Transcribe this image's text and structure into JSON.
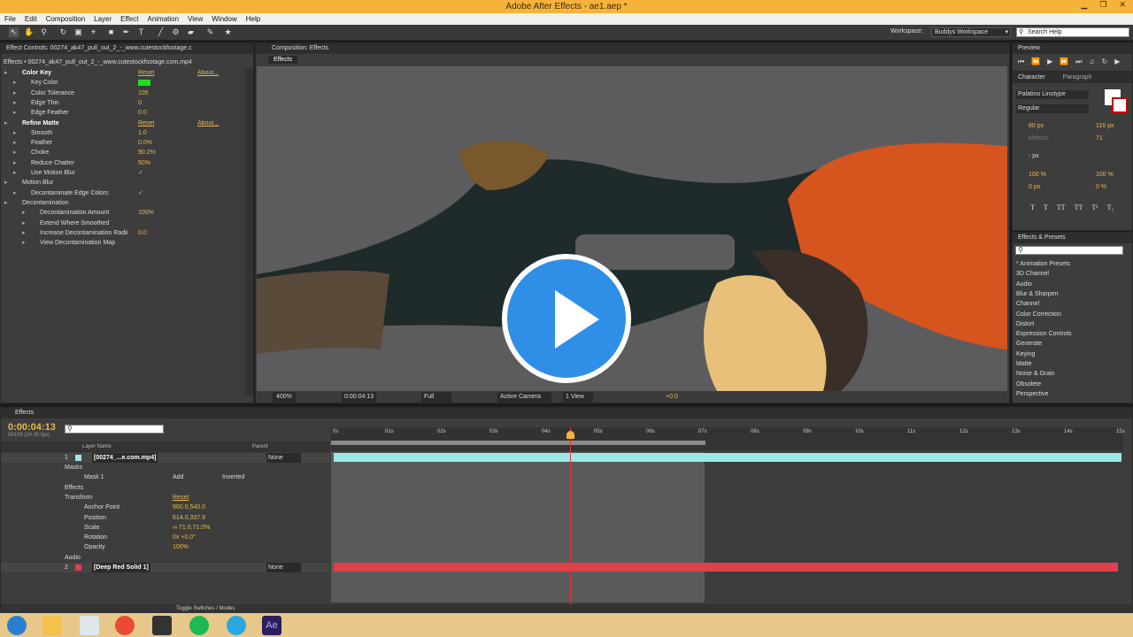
{
  "window": {
    "title": "Adobe After Effects - ae1.aep *"
  },
  "menu": [
    "File",
    "Edit",
    "Composition",
    "Layer",
    "Effect",
    "Animation",
    "View",
    "Window",
    "Help"
  ],
  "toolbar": {
    "workspace_label": "Workspace:",
    "workspace_value": "Buddys Workspace",
    "search_placeholder": "Search Help"
  },
  "effect_controls": {
    "tab": "Effect Controls: 00274_ak47_pull_out_2_-_www.cutestockfootage.c",
    "header": "Effects • 00274_ak47_pull_out_2_-_www.cutestockfootage.com.mp4",
    "rows": [
      {
        "label": "Color Key",
        "value": "Reset",
        "extra": "About...",
        "type": "section",
        "indent": 0
      },
      {
        "label": "Key Color",
        "value": "",
        "type": "color",
        "indent": 1
      },
      {
        "label": "Color Tolerance",
        "value": "105",
        "indent": 1
      },
      {
        "label": "Edge Thin",
        "value": "0",
        "indent": 1
      },
      {
        "label": "Edge Feather",
        "value": "0.0",
        "indent": 1
      },
      {
        "label": "Refine Matte",
        "value": "Reset",
        "extra": "About...",
        "type": "section",
        "indent": 0
      },
      {
        "label": "Smooth",
        "value": "1.0",
        "indent": 1
      },
      {
        "label": "Feather",
        "value": "0.0%",
        "indent": 1
      },
      {
        "label": "Choke",
        "value": "90.2%",
        "indent": 1
      },
      {
        "label": "Reduce Chatter",
        "value": "50%",
        "indent": 1
      },
      {
        "label": "Use Motion Blur",
        "value": "✓",
        "type": "check",
        "indent": 1
      },
      {
        "label": "Motion Blur",
        "value": "",
        "indent": 0
      },
      {
        "label": "Decontaminate Edge Colors",
        "value": "✓",
        "type": "check",
        "indent": 1
      },
      {
        "label": "Decontamination",
        "value": "",
        "indent": 0
      },
      {
        "label": "Decontamination Amount",
        "value": "100%",
        "indent": 2
      },
      {
        "label": "Extend Where Smoothed",
        "value": "",
        "type": "check",
        "indent": 2
      },
      {
        "label": "Increase Decontamination Radii",
        "value": "0.0",
        "indent": 2
      },
      {
        "label": "View Decontamination Map",
        "value": "",
        "type": "check",
        "indent": 2
      }
    ]
  },
  "composition": {
    "tab": "Composition: Effects",
    "subtab": "Effects",
    "zoom": "400%",
    "timecode": "0:00:04:13",
    "resolution": "Full",
    "camera": "Active Camera",
    "views": "1 View",
    "exposure": "+0.0"
  },
  "preview": {
    "tab": "Preview"
  },
  "character": {
    "tab": "Character",
    "tab2": "Paragraph",
    "font": "Palatino Linotype",
    "style": "Regular",
    "size": "80 px",
    "leading": "116 px",
    "kerning": "Metrics",
    "tracking": "71",
    "stroke": "- px",
    "vscale": "100 %",
    "hscale": "100 %",
    "baseline": "0 px",
    "tsume": "0 %"
  },
  "effects_presets": {
    "tab": "Effects & Presets",
    "items": [
      "* Animation Presets",
      "3D Channel",
      "Audio",
      "Blur & Sharpen",
      "Channel",
      "Color Correction",
      "Distort",
      "Expression Controls",
      "Generate",
      "Keying",
      "Matte",
      "Noise & Grain",
      "Obsolete",
      "Perspective"
    ]
  },
  "timeline": {
    "tab": "Effects",
    "timecode": "0:00:04:13",
    "fps": "00109 (24.00 fps)",
    "col_layername": "Layer Name",
    "col_parent": "Parent",
    "ruler": [
      "0s",
      "01s",
      "02s",
      "03s",
      "04s",
      "05s",
      "06s",
      "07s",
      "08s",
      "09s",
      "10s",
      "11s",
      "12s",
      "13s",
      "14s",
      "15s"
    ],
    "layers": [
      {
        "num": "1",
        "name": "[00274_...e.com.mp4]",
        "parent": "None"
      },
      {
        "num": "2",
        "name": "[Deep Red Solid 1]",
        "parent": "None"
      }
    ],
    "props": [
      {
        "label": "Masks",
        "value": ""
      },
      {
        "label": "Mask 1",
        "value": "Add",
        "extra": "Inverted"
      },
      {
        "label": "Effects",
        "value": ""
      },
      {
        "label": "Transform",
        "value": "Reset"
      },
      {
        "label": "Anchor Point",
        "value": "960.0,540.0"
      },
      {
        "label": "Position",
        "value": "614.0,337.9"
      },
      {
        "label": "Scale",
        "value": "∞ 71.0,71.0%"
      },
      {
        "label": "Rotation",
        "value": "0x +0.0°"
      },
      {
        "label": "Opacity",
        "value": "100%"
      },
      {
        "label": "Audio",
        "value": ""
      }
    ],
    "toggle": "Toggle Switches / Modes"
  },
  "colors": {
    "accent": "#f6b23a",
    "track_cyan": "#9fe6e6",
    "track_red": "#e0404a",
    "key_green": "#22dd22",
    "play_blue": "#2f8fe6"
  }
}
